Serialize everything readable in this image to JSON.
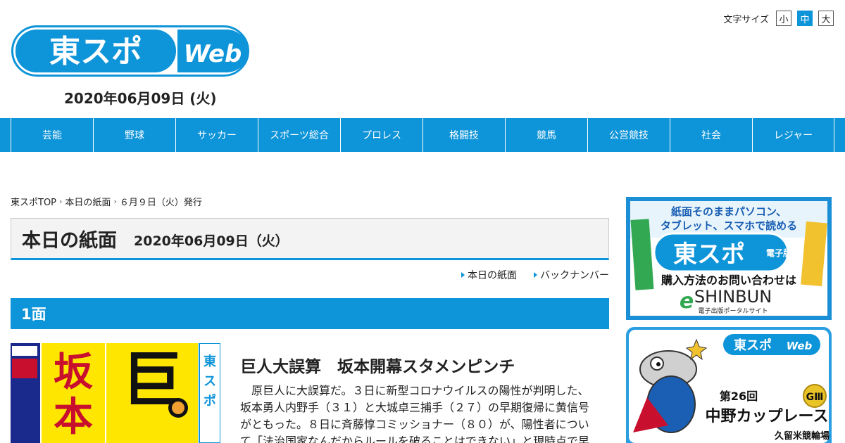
{
  "header": {
    "logo_text": "東スポ",
    "logo_web": "Web",
    "date": "2020年06月09日 (火)",
    "font_size": {
      "label": "文字サイズ",
      "options": [
        "小",
        "中",
        "大"
      ],
      "selected": "中"
    }
  },
  "nav": {
    "items": [
      "芸能",
      "野球",
      "サッカー",
      "スポーツ総合",
      "プロレス",
      "格闘技",
      "競馬",
      "公営競技",
      "社会",
      "レジャー"
    ]
  },
  "breadcrumb": {
    "items": [
      "東スポTOP",
      "本日の紙面",
      "６月９日（火）発行"
    ]
  },
  "page": {
    "title": "本日の紙面",
    "date": "2020年06月09日（火）",
    "links": [
      "本日の紙面",
      "バックナンバー"
    ]
  },
  "section": {
    "label": "1面"
  },
  "paper": {
    "headline_left": "坂本開",
    "headline_right": "巨人",
    "masthead": "東スポ"
  },
  "article": {
    "title": "巨人大誤算　坂本開幕スタメンピンチ",
    "body": "　原巨人に大誤算だ。３日に新型コロナウイルスの陽性が判明した、坂本勇人内野手（３１）と大城卓三捕手（２７）の早期復帰に黄信号がともった。８日に斉藤惇コミッショナー（８０）が、陽性者について「法治国家なんだからルールを破ることはできない」と現時点で早"
  },
  "ads": {
    "ad1": {
      "line1": "紙面そのままパソコン、",
      "line2": "タブレット、スマホで読める",
      "brand": "東スポ",
      "edition": "電子版",
      "cta": "購入方法のお問い合わせは",
      "service": "SHINBUN",
      "service_prefix": "e",
      "service_sub": "電子出版ポータルサイト"
    },
    "ad2": {
      "brand": "東スポ",
      "brand_web": "Web",
      "race_no": "第26回",
      "race_name": "中野カップレース",
      "grade": "GⅢ",
      "venue": "久留米競輪場"
    }
  },
  "colors": {
    "accent": "#0e94d8",
    "title_bg": "#f3f3f3"
  }
}
